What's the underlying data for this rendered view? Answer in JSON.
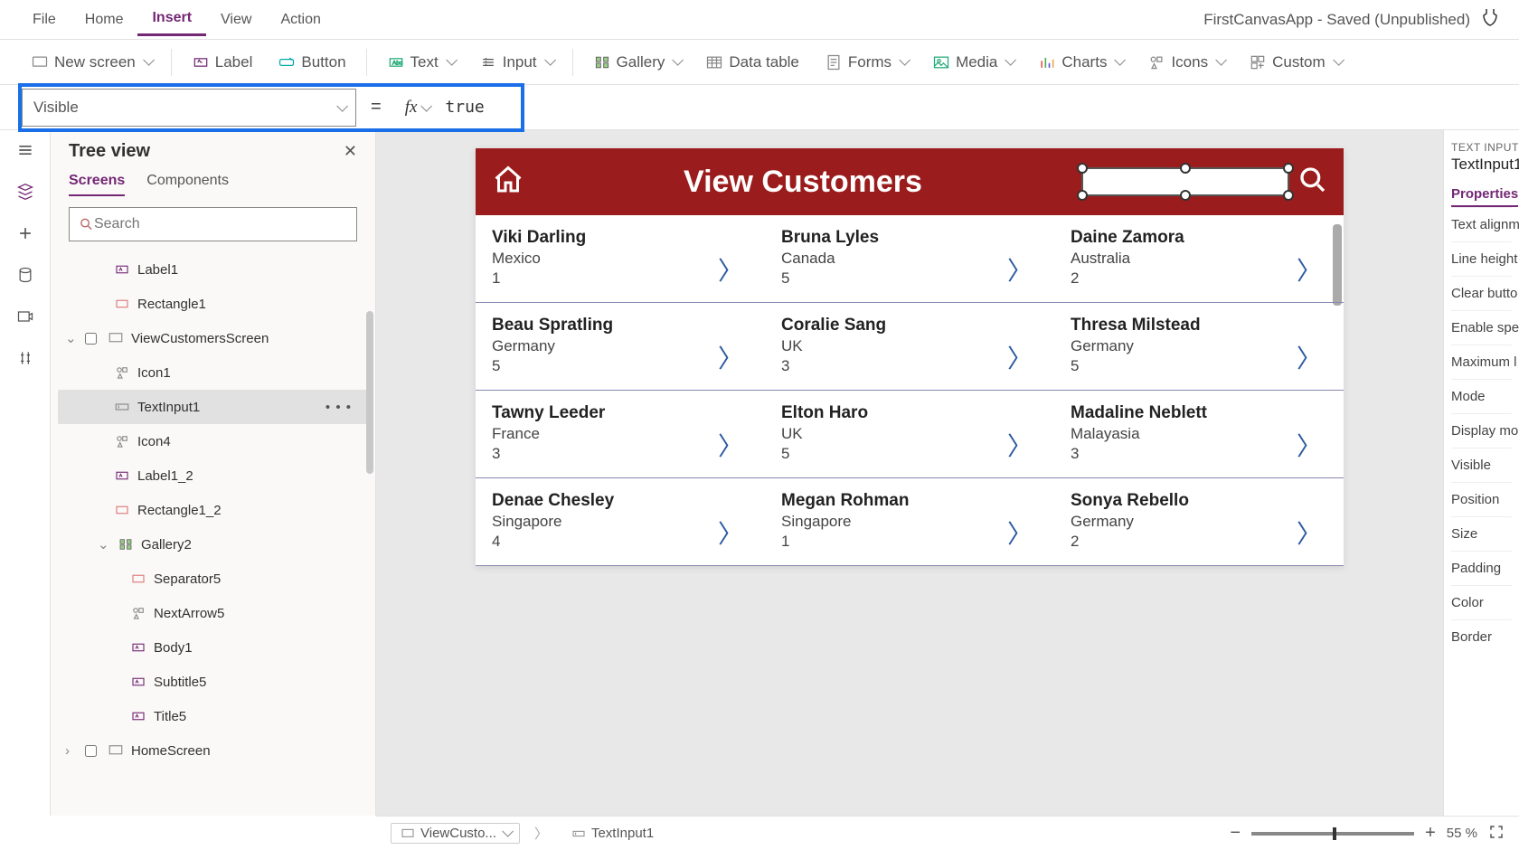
{
  "appTitle": "FirstCanvasApp - Saved (Unpublished)",
  "menu": {
    "file": "File",
    "home": "Home",
    "insert": "Insert",
    "view": "View",
    "action": "Action"
  },
  "ribbon": {
    "newScreen": "New screen",
    "label": "Label",
    "button": "Button",
    "text": "Text",
    "input": "Input",
    "gallery": "Gallery",
    "dataTable": "Data table",
    "forms": "Forms",
    "media": "Media",
    "charts": "Charts",
    "icons": "Icons",
    "custom": "Custom"
  },
  "formula": {
    "property": "Visible",
    "expr": "true"
  },
  "treeView": {
    "title": "Tree view",
    "tabs": {
      "screens": "Screens",
      "components": "Components"
    },
    "searchPlaceholder": "Search",
    "nodes": [
      {
        "label": "Label1",
        "type": "label",
        "level": "child2"
      },
      {
        "label": "Rectangle1",
        "type": "rect",
        "level": "child2"
      },
      {
        "label": "ViewCustomersScreen",
        "type": "screen",
        "level": "screen",
        "expand": "open"
      },
      {
        "label": "Icon1",
        "type": "icons",
        "level": "child2"
      },
      {
        "label": "TextInput1",
        "type": "textinput",
        "level": "child2",
        "selected": true,
        "more": true
      },
      {
        "label": "Icon4",
        "type": "icons",
        "level": "child2"
      },
      {
        "label": "Label1_2",
        "type": "label",
        "level": "child2"
      },
      {
        "label": "Rectangle1_2",
        "type": "rect",
        "level": "child2"
      },
      {
        "label": "Gallery2",
        "type": "gallery",
        "level": "child1",
        "expand": "open"
      },
      {
        "label": "Separator5",
        "type": "rect",
        "level": "child3"
      },
      {
        "label": "NextArrow5",
        "type": "icons",
        "level": "child3"
      },
      {
        "label": "Body1",
        "type": "label",
        "level": "child3"
      },
      {
        "label": "Subtitle5",
        "type": "label",
        "level": "child3"
      },
      {
        "label": "Title5",
        "type": "label",
        "level": "child3"
      },
      {
        "label": "HomeScreen",
        "type": "screen",
        "level": "screen",
        "expand": "closed"
      }
    ]
  },
  "canvas": {
    "headerTitle": "View Customers",
    "customers": [
      {
        "name": "Viki  Darling",
        "country": "Mexico",
        "num": "1"
      },
      {
        "name": "Bruna  Lyles",
        "country": "Canada",
        "num": "5"
      },
      {
        "name": "Daine  Zamora",
        "country": "Australia",
        "num": "2"
      },
      {
        "name": "Beau  Spratling",
        "country": "Germany",
        "num": "5"
      },
      {
        "name": "Coralie  Sang",
        "country": "UK",
        "num": "3"
      },
      {
        "name": "Thresa  Milstead",
        "country": "Germany",
        "num": "5"
      },
      {
        "name": "Tawny  Leeder",
        "country": "France",
        "num": "3"
      },
      {
        "name": "Elton  Haro",
        "country": "UK",
        "num": "5"
      },
      {
        "name": "Madaline  Neblett",
        "country": "Malayasia",
        "num": "3"
      },
      {
        "name": "Denae  Chesley",
        "country": "Singapore",
        "num": "4"
      },
      {
        "name": "Megan  Rohman",
        "country": "Singapore",
        "num": "1"
      },
      {
        "name": "Sonya  Rebello",
        "country": "Germany",
        "num": "2"
      }
    ]
  },
  "props": {
    "typeLabel": "TEXT INPUT",
    "name": "TextInput1",
    "tab": "Properties",
    "rows": [
      "Text alignm",
      "Line height",
      "Clear butto",
      "Enable spel",
      "Maximum l",
      "Mode",
      "Display mo",
      "Visible",
      "Position",
      "Size",
      "Padding",
      "Color",
      "Border"
    ]
  },
  "status": {
    "crumb1": "ViewCusto...",
    "crumb2": "TextInput1",
    "zoom": "55  %"
  }
}
